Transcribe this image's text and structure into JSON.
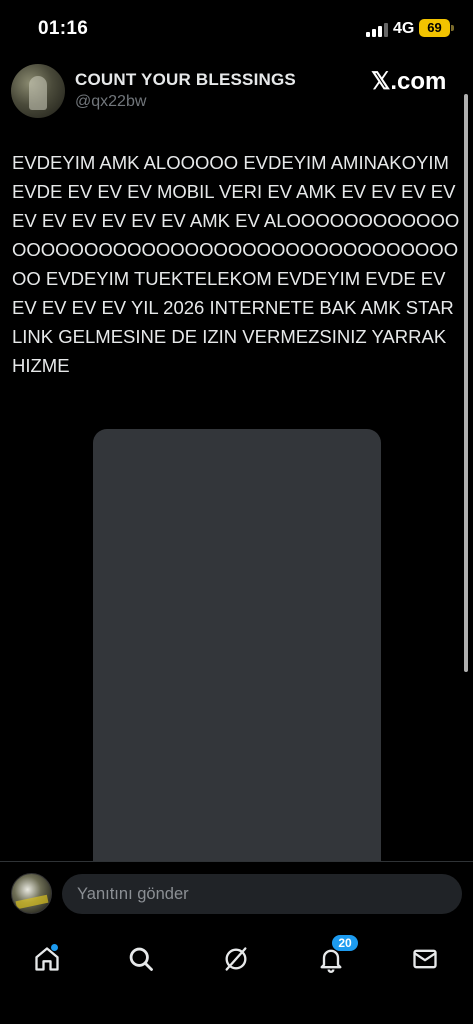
{
  "status_bar": {
    "time": "01:16",
    "network": "4G",
    "battery": "69",
    "battery_color": "#f2c300"
  },
  "header": {
    "author_name": "COUNT YOUR BLESSINGS",
    "author_handle": "@qx22bw",
    "brand": "𝕏.com"
  },
  "post": {
    "text": "EVDEYIM AMK ALOOOOO EVDEYIM AMINAKOYIM EVDE EV EV EV MOBIL VERI EV AMK EV EV EV EV EV EV EV EV EV EV AMK EV ALOOOOOOOOOOOOOOOOOOOOOOOOOOOOOOOOOOOOOOOOOOOOO EVDEYIM TUEKTELEKOM EVDEYIM EVDE EV EV EV EV EV YIL 2026 INTERNETE BAK AMK STARLINK GELMESINE DE IZIN VERMEZSINIZ YARRAK HIZME",
    "media_color": "#33363a"
  },
  "reply": {
    "placeholder": "Yanıtını gönder"
  },
  "nav": {
    "items": [
      {
        "name": "home",
        "icon": "home-icon",
        "has_dot": true
      },
      {
        "name": "search",
        "icon": "search-icon"
      },
      {
        "name": "grok",
        "icon": "grok-icon"
      },
      {
        "name": "notifications",
        "icon": "bell-icon",
        "badge": "20"
      },
      {
        "name": "messages",
        "icon": "mail-icon"
      }
    ],
    "accent": "#1d9bf0"
  }
}
